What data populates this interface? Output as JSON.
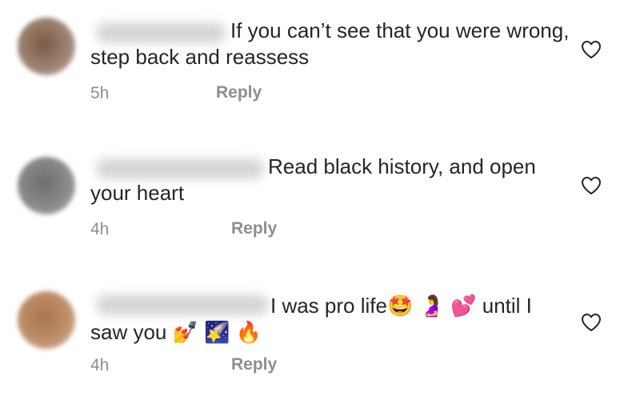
{
  "comments": [
    {
      "text": "If you can’t see that you were wrong, step back and reassess",
      "time": "5h",
      "reply_label": "Reply",
      "like_icon": "heart-outline-icon"
    },
    {
      "text": "Read black history, and open your heart",
      "time": "4h",
      "reply_label": "Reply",
      "like_icon": "heart-outline-icon"
    },
    {
      "text": "I was pro life🤩 🤰 💕 until I saw you 💅 🌠 🔥",
      "time": "4h",
      "reply_label": "Reply",
      "like_icon": "heart-outline-icon"
    }
  ],
  "colors": {
    "text": "#262626",
    "secondary": "#8e8e8e"
  }
}
